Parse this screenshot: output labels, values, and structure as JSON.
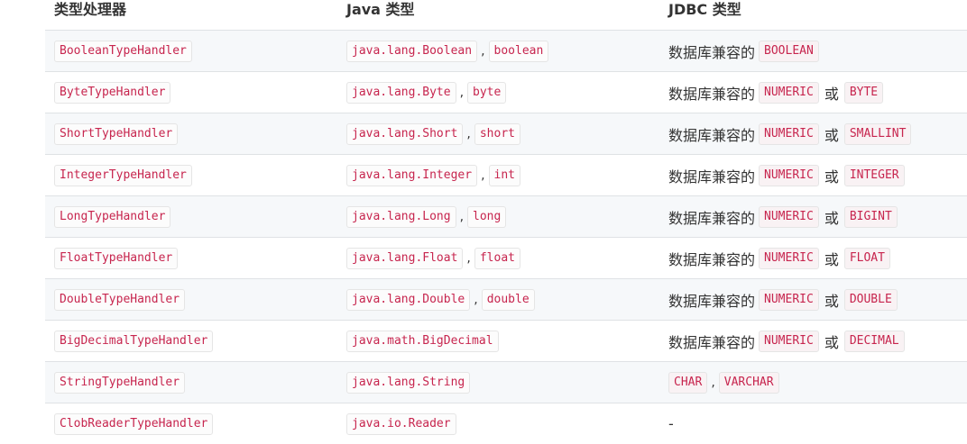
{
  "headers": {
    "handler": "类型处理器",
    "java": "Java 类型",
    "jdbc": "JDBC 类型"
  },
  "rows": [
    {
      "handler": "BooleanTypeHandler",
      "java1": "java.lang.Boolean",
      "java2": "boolean",
      "prefix": "数据库兼容的",
      "jdbc1": "BOOLEAN",
      "jdbc2": ""
    },
    {
      "handler": "ByteTypeHandler",
      "java1": "java.lang.Byte",
      "java2": "byte",
      "prefix": "数据库兼容的",
      "jdbc1": "NUMERIC",
      "or": "或",
      "jdbc2": "BYTE"
    },
    {
      "handler": "ShortTypeHandler",
      "java1": "java.lang.Short",
      "java2": "short",
      "prefix": "数据库兼容的",
      "jdbc1": "NUMERIC",
      "or": "或",
      "jdbc2": "SMALLINT"
    },
    {
      "handler": "IntegerTypeHandler",
      "java1": "java.lang.Integer",
      "java2": "int",
      "prefix": "数据库兼容的",
      "jdbc1": "NUMERIC",
      "or": "或",
      "jdbc2": "INTEGER"
    },
    {
      "handler": "LongTypeHandler",
      "java1": "java.lang.Long",
      "java2": "long",
      "prefix": "数据库兼容的",
      "jdbc1": "NUMERIC",
      "or": "或",
      "jdbc2": "BIGINT"
    },
    {
      "handler": "FloatTypeHandler",
      "java1": "java.lang.Float",
      "java2": "float",
      "prefix": "数据库兼容的",
      "jdbc1": "NUMERIC",
      "or": "或",
      "jdbc2": "FLOAT"
    },
    {
      "handler": "DoubleTypeHandler",
      "java1": "java.lang.Double",
      "java2": "double",
      "prefix": "数据库兼容的",
      "jdbc1": "NUMERIC",
      "or": "或",
      "jdbc2": "DOUBLE"
    },
    {
      "handler": "BigDecimalTypeHandler",
      "java1": "java.math.BigDecimal",
      "java2": "",
      "prefix": "数据库兼容的",
      "jdbc1": "NUMERIC",
      "or": "或",
      "jdbc2": "DECIMAL"
    },
    {
      "handler": "StringTypeHandler",
      "java1": "java.lang.String",
      "java2": "",
      "prefix": "",
      "jdbc1": "CHAR",
      "sep": ",",
      "jdbc2": "VARCHAR"
    },
    {
      "handler": "ClobReaderTypeHandler",
      "java1": "java.io.Reader",
      "java2": "",
      "prefix": "",
      "dash": "-"
    }
  ],
  "comma": ","
}
